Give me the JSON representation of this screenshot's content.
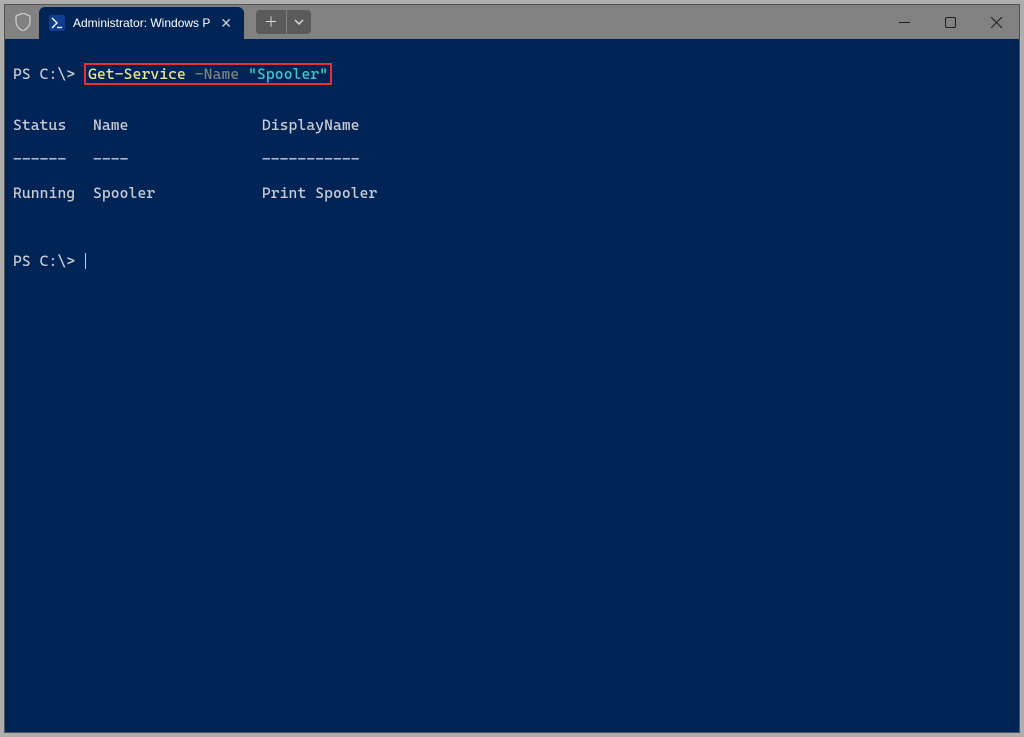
{
  "titlebar": {
    "tab_title": "Administrator: Windows Powe",
    "ps_icon_text": ">_"
  },
  "terminal": {
    "prompt1": "PS C:\\> ",
    "cmd_main": "Get-Service",
    "cmd_param": " -Name ",
    "cmd_value": "\"Spooler\"",
    "blank": "",
    "header": "Status   Name               DisplayName",
    "separator": "------   ----               -----------",
    "row": "Running  Spooler            Print Spooler",
    "prompt2": "PS C:\\> "
  }
}
